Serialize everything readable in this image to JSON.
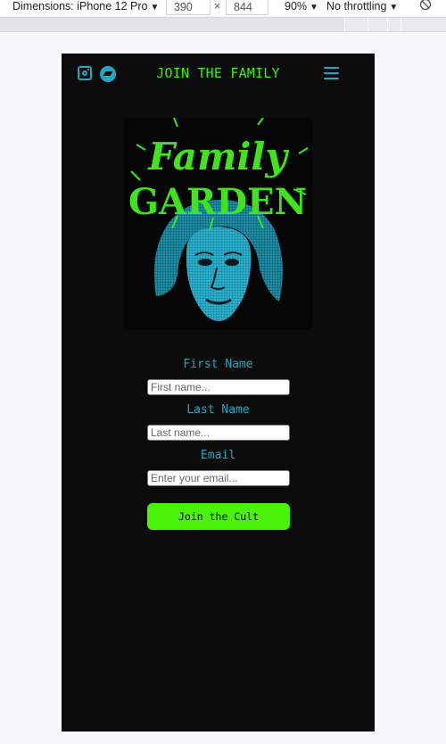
{
  "devtools": {
    "dimensions_label": "Dimensions: iPhone 12 Pro",
    "width_value": "390",
    "times_symbol": "×",
    "height_value": "844",
    "zoom": "90%",
    "throttling": "No throttling",
    "caret": "▼"
  },
  "nav": {
    "title": "JOIN THE FAMILY",
    "icons": [
      "instagram-icon",
      "bandcamp-icon",
      "hamburger-menu-icon"
    ]
  },
  "artwork": {
    "logo_line1": "Family",
    "logo_line2": "GARDEN"
  },
  "form": {
    "first_name_label": "First Name",
    "first_name_placeholder": "First name...",
    "last_name_label": "Last Name",
    "last_name_placeholder": "Last name...",
    "email_label": "Email",
    "email_placeholder": "Enter your email...",
    "submit_label": "Join the Cult"
  },
  "colors": {
    "background": "#0b0b0b",
    "accent_green": "#49f207",
    "accent_cyan": "#1fa8c4"
  }
}
